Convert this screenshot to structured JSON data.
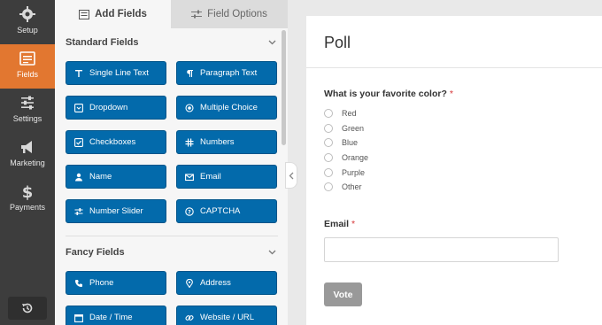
{
  "nav": {
    "items": [
      {
        "label": "Setup",
        "icon": "gear-icon"
      },
      {
        "label": "Fields",
        "icon": "list-form-icon",
        "active": true
      },
      {
        "label": "Settings",
        "icon": "sliders-icon"
      },
      {
        "label": "Marketing",
        "icon": "megaphone-icon"
      },
      {
        "label": "Payments",
        "icon": "dollar-icon"
      }
    ],
    "bottom_icon": "history-icon"
  },
  "tabs": {
    "add_fields": "Add Fields",
    "field_options": "Field Options"
  },
  "standard_fields": {
    "heading": "Standard Fields",
    "buttons": [
      "Single Line Text",
      "Paragraph Text",
      "Dropdown",
      "Multiple Choice",
      "Checkboxes",
      "Numbers",
      "Name",
      "Email",
      "Number Slider",
      "CAPTCHA"
    ]
  },
  "fancy_fields": {
    "heading": "Fancy Fields",
    "buttons": [
      "Phone",
      "Address",
      "Date / Time",
      "Website / URL"
    ]
  },
  "form": {
    "title": "Poll",
    "question": "What is your favorite color?",
    "required_mark": "*",
    "options": [
      "Red",
      "Green",
      "Blue",
      "Orange",
      "Purple",
      "Other"
    ],
    "email_label": "Email",
    "email_value": "",
    "submit_label": "Vote"
  },
  "colors": {
    "accent": "#e27730",
    "field_button": "#036aab",
    "nav_bg": "#3d3d3d",
    "required": "#d63638"
  }
}
